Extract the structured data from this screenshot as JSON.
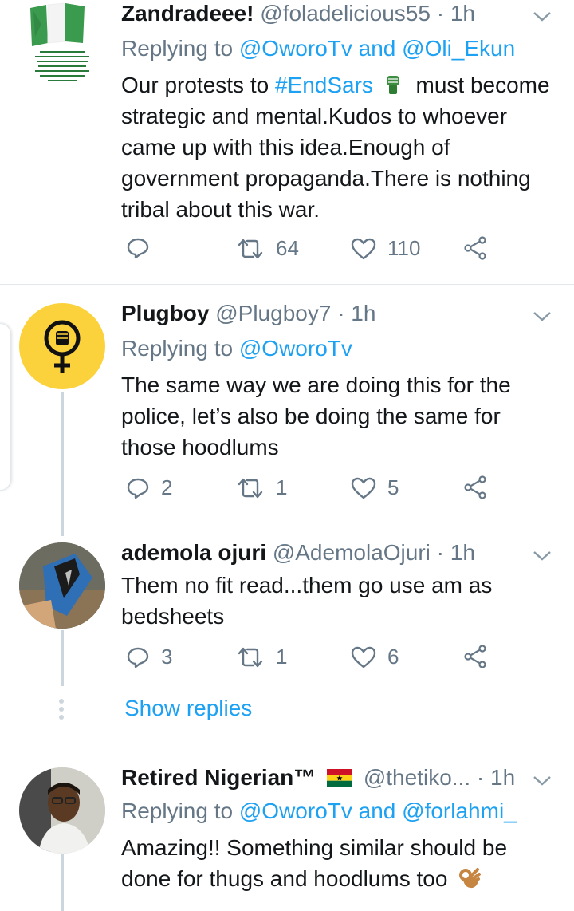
{
  "tweets": [
    {
      "name": "Zandradeee!",
      "handle": "@foladelicious55",
      "time": "· 1h",
      "replying_label": "Replying to",
      "mentions": [
        "@OworoTv",
        "@Oli_Ekun"
      ],
      "joiner": "and",
      "text_before": "Our protests to",
      "hashtag": "#EndSars",
      "text_after": "must become strategic and mental.Kudos to whoever came up with this idea.Enough of government propaganda.There is nothing tribal about this war.",
      "replies": "",
      "retweets": "64",
      "likes": "110",
      "avatar_color": "#ffffff"
    },
    {
      "name": "Plugboy",
      "handle": "@Plugboy7",
      "time": "· 1h",
      "replying_label": "Replying to",
      "mentions": [
        "@OworoTv"
      ],
      "text": "The same way we are doing this for the police, let’s also be doing the same for those hoodlums",
      "replies": "2",
      "retweets": "1",
      "likes": "5",
      "avatar_color": "#fcd23c"
    },
    {
      "name": "ademola ojuri",
      "handle": "@AdemolaOjuri",
      "time": "· 1h",
      "text": "Them no fit read...them go use am as bedsheets",
      "replies": "3",
      "retweets": "1",
      "likes": "6",
      "show_replies": "Show replies"
    },
    {
      "name": "Retired Nigerian™",
      "handle": "@thetiko...",
      "time": "· 1h",
      "replying_label": "Replying to",
      "mentions": [
        "@OworoTv",
        "@forlahmi_"
      ],
      "joiner": "and",
      "text": "Amazing!! Something similar should be done for thugs and hoodlums too"
    }
  ],
  "colors": {
    "accent": "#1da1f2",
    "secondary_text": "#657786",
    "divider": "#e1e8ed"
  },
  "icons": {
    "reply": "reply-icon",
    "retweet": "retweet-icon",
    "like": "heart-icon",
    "share": "share-icon",
    "more": "chevron-down-icon"
  }
}
